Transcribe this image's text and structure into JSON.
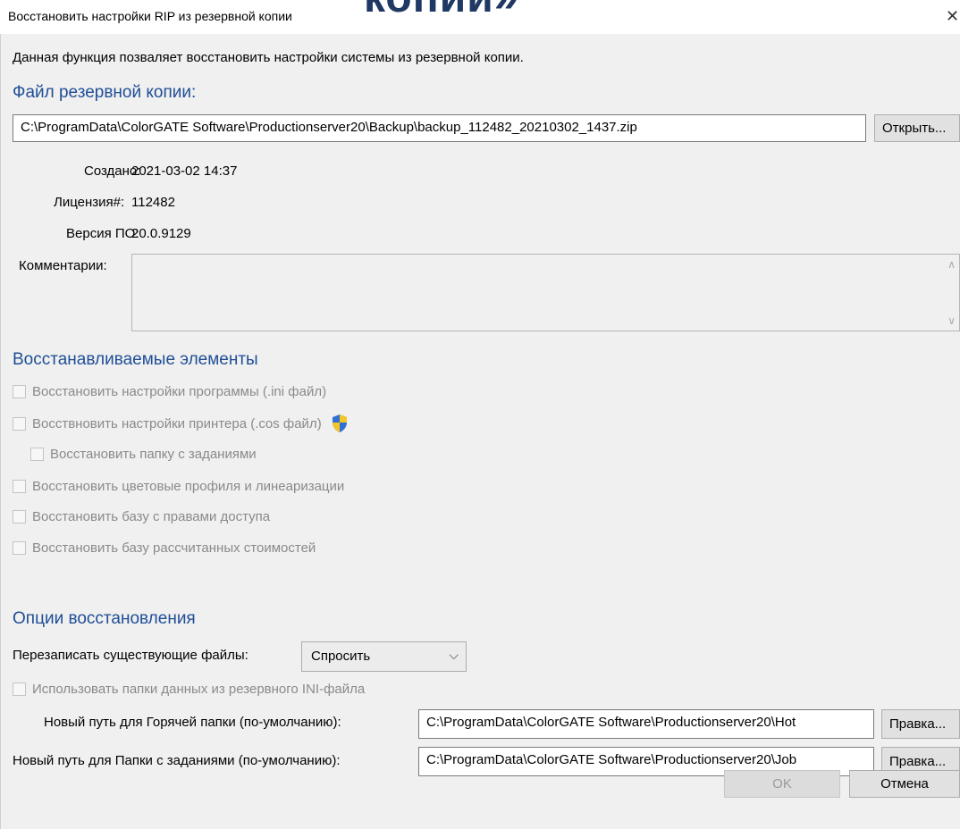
{
  "window": {
    "title": "Восстановить настройки RIP из резервной копии",
    "overlay_heading": "копии»",
    "close_glyph": "✕"
  },
  "description": "Данная функция позваляет восстановить настройки системы из резервной копии.",
  "backup_file": {
    "heading": "Файл резервной копии:",
    "path": "C:\\ProgramData\\ColorGATE Software\\Productionserver20\\Backup\\backup_112482_20210302_1437.zip",
    "open_button": "Открыть..."
  },
  "info": {
    "created_label": "Создано:",
    "created_value": "2021-03-02 14:37",
    "license_label": "Лицензия#:",
    "license_value": "112482",
    "version_label": "Версия ПО:",
    "version_value": "20.0.9129",
    "comment_label": "Комментарии:",
    "comment_value": ""
  },
  "restore_items": {
    "heading": "Восстанавливаемые элементы",
    "items": [
      {
        "label": "Восстановить настройки программы (.ini файл)",
        "checked": false,
        "enabled": false
      },
      {
        "label": "Восствновить настройки принтера (.cos файл)",
        "checked": false,
        "enabled": false,
        "icon": "shield-icon"
      },
      {
        "label": "Восстановить папку с заданиями",
        "checked": false,
        "enabled": false
      },
      {
        "label": "Восстановить цветовые профиля и линеаризации",
        "checked": false,
        "enabled": false
      },
      {
        "label": "Восстановить базу с правами доступа",
        "checked": false,
        "enabled": false
      },
      {
        "label": "Восстановить базу рассчитанных стоимостей",
        "checked": false,
        "enabled": false
      }
    ]
  },
  "options": {
    "heading": "Опции восстановления",
    "overwrite_label": "Перезаписать существующие файлы:",
    "overwrite_value": "Спросить",
    "use_ini_label": "Использовать папки данных из резервного INI-файла",
    "hot_label": "Новый путь для Горячей папки (по-умолчанию):",
    "hot_value": "C:\\ProgramData\\ColorGATE Software\\Productionserver20\\Hot",
    "hot_button": "Правка...",
    "job_label": "Новый путь для Папки с заданиями (по-умолчанию):",
    "job_value": "C:\\ProgramData\\ColorGATE Software\\Productionserver20\\Job",
    "job_button": "Правка..."
  },
  "footer": {
    "ok": "OK",
    "cancel": "Отмена"
  },
  "colors": {
    "heading_blue": "#1f4e96",
    "overlay_navy": "#1f3864",
    "shield_blue": "#2f6fd6",
    "shield_yellow": "#f3c623"
  }
}
